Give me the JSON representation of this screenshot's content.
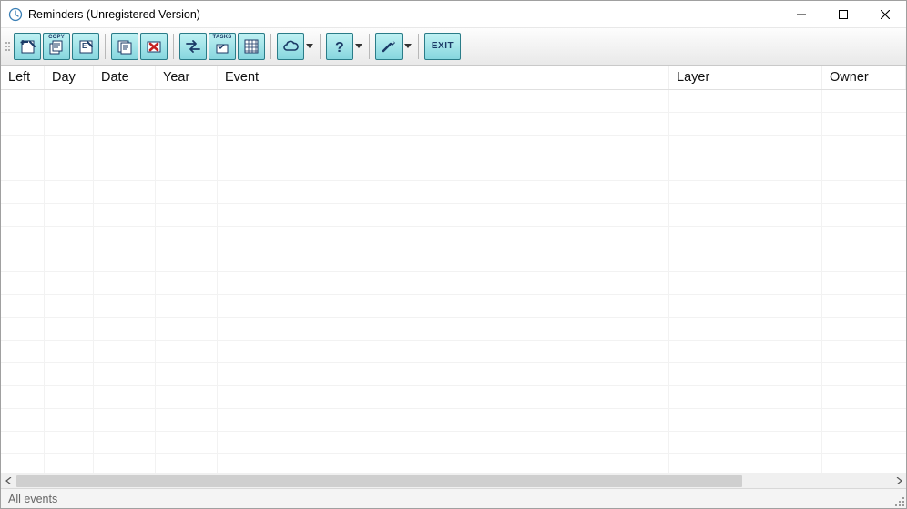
{
  "window": {
    "title": "Reminders (Unregistered Version)"
  },
  "toolbar": {
    "copy_label": "COPY",
    "tasks_label": "TASKS",
    "exit_label": "EXIT"
  },
  "columns": {
    "left": "Left",
    "day": "Day",
    "date": "Date",
    "year": "Year",
    "event": "Event",
    "layer": "Layer",
    "owner": "Owner"
  },
  "status": {
    "text": "All events"
  }
}
